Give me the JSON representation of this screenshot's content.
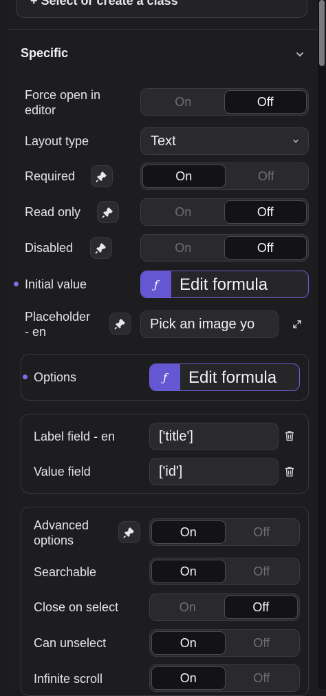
{
  "class_selector": {
    "label": "+ Select or create a class"
  },
  "section": {
    "title": "Specific"
  },
  "rows": {
    "force_open": {
      "label_line1": "Force open in",
      "label_line2": "editor",
      "on": "On",
      "off": "Off",
      "value": "Off"
    },
    "layout_type": {
      "label": "Layout type",
      "value": "Text"
    },
    "required": {
      "label": "Required",
      "on": "On",
      "off": "Off",
      "value": "On"
    },
    "read_only": {
      "label": "Read only",
      "on": "On",
      "off": "Off",
      "value": "Off"
    },
    "disabled": {
      "label": "Disabled",
      "on": "On",
      "off": "Off",
      "value": "Off"
    },
    "initial_value": {
      "label": "Initial value",
      "button": "Edit formula",
      "fx": "ƒ"
    },
    "placeholder": {
      "label_line1": "Placeholder",
      "label_line2": "- en",
      "value": "Pick an image yo"
    }
  },
  "options_box": {
    "label": "Options",
    "button": "Edit formula",
    "fx": "ƒ"
  },
  "fields_box": {
    "label_field": {
      "label": "Label field - en",
      "value": "['title']"
    },
    "value_field": {
      "label": "Value field",
      "value": "['id']"
    }
  },
  "advanced_box": {
    "advanced_options": {
      "label_line1": "Advanced",
      "label_line2": "options",
      "on": "On",
      "off": "Off",
      "value": "On"
    },
    "searchable": {
      "label": "Searchable",
      "on": "On",
      "off": "Off",
      "value": "On"
    },
    "close_on_select": {
      "label": "Close on select",
      "on": "On",
      "off": "Off",
      "value": "Off"
    },
    "can_unselect": {
      "label": "Can unselect",
      "on": "On",
      "off": "Off",
      "value": "On"
    },
    "infinite_scroll": {
      "label": "Infinite scroll",
      "on": "On",
      "off": "Off",
      "value": "On"
    }
  },
  "colors": {
    "accent": "#6557d2",
    "background": "#1d1d20"
  }
}
